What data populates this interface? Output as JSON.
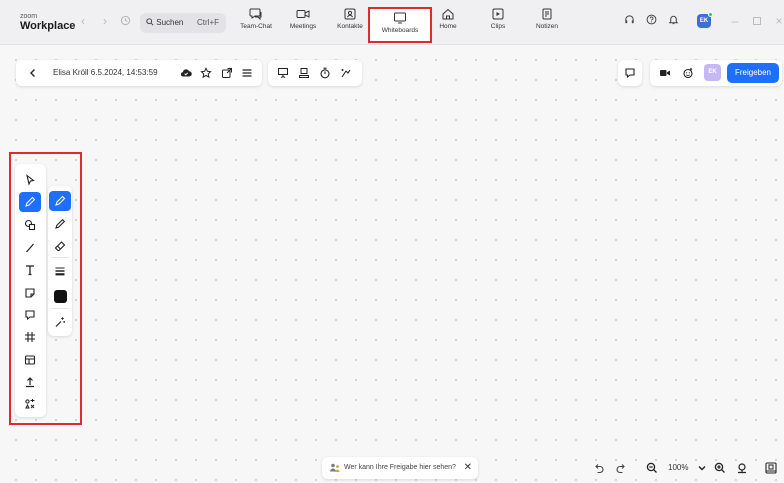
{
  "app": {
    "logo_small": "zoom",
    "logo_name": "Workplace"
  },
  "search": {
    "label": "Suchen",
    "shortcut": "Ctrl+F"
  },
  "tabs": [
    {
      "label": "Team-Chat",
      "icon": "chat-icon"
    },
    {
      "label": "Meetings",
      "icon": "video-icon"
    },
    {
      "label": "Kontakte",
      "icon": "contacts-icon"
    },
    {
      "label": "Whiteboards",
      "icon": "whiteboard-icon",
      "active": true
    },
    {
      "label": "Home",
      "icon": "home-icon"
    },
    {
      "label": "Clips",
      "icon": "clips-icon"
    },
    {
      "label": "Notizen",
      "icon": "notes-icon"
    }
  ],
  "user": {
    "initials": "EK",
    "status_color": "#2cc46a"
  },
  "whiteboard": {
    "title": "Elisa Kröll 6.5.2024, 14:53:59",
    "share_label": "Freigeben",
    "collaborator_initials": "EK"
  },
  "tools": [
    "select-tool",
    "pen-tool",
    "shapes-tool",
    "line-tool",
    "text-tool",
    "sticky-note-tool",
    "comment-tool",
    "frame-tool",
    "template-tool",
    "upload-tool",
    "more-tools"
  ],
  "pen_options": [
    "pen",
    "pencil",
    "eraser",
    "stroke-width",
    "color",
    "magic-pen"
  ],
  "colors": {
    "accent": "#1f6fff",
    "highlight": "#e02b2b",
    "pen_color": "#111111"
  },
  "bottom": {
    "visibility_text": "Wer kann Ihre Freigabe hier sehen?",
    "zoom_level": "100%"
  }
}
